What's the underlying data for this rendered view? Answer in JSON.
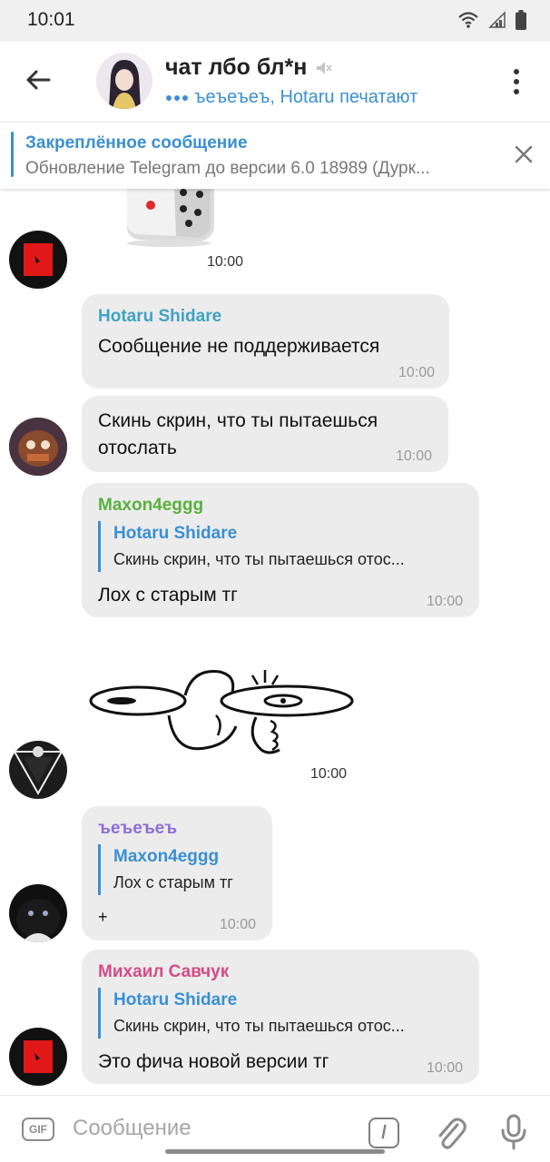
{
  "status": {
    "time": "10:01"
  },
  "header": {
    "title": "чат лбо бл*н",
    "subtitle": "ъеъеъеъ, Hotaru печатают"
  },
  "pinned": {
    "title": "Закреплённое сообщение",
    "text": "Обновление Telegram до версии 6.0 18989 (Дурк..."
  },
  "messages": [
    {
      "type": "sticker",
      "time": "10:00"
    },
    {
      "sender": "Hotaru Shidare",
      "text": "Сообщение не поддерживается",
      "time": "10:00",
      "sender_color": "#3fa2c4"
    },
    {
      "text_lines": [
        "Скинь скрин, что ты пытаешься",
        "отослать"
      ],
      "time": "10:00"
    },
    {
      "sender": "Maxon4eggg",
      "sender_color": "#58b03d",
      "reply": {
        "name": "Hotaru Shidare",
        "text": "Скинь скрин, что ты пытаешься отос..."
      },
      "text": "Лох с старым тг",
      "time": "10:00"
    },
    {
      "type": "sticker",
      "time": "10:00"
    },
    {
      "sender": "ъеъеъеъ",
      "sender_color": "#8c6fd8",
      "reply": {
        "name": "Maxon4eggg",
        "text": "Лох с старым тг"
      },
      "text": "+",
      "time": "10:00"
    },
    {
      "sender": "Михаил Савчук",
      "sender_color": "#d44b86",
      "reply": {
        "name": "Hotaru Shidare",
        "text": "Скинь скрин, что ты пытаешься отос..."
      },
      "text": "Это фича новой версии тг",
      "time": "10:00"
    }
  ],
  "composer": {
    "gif_label": "GIF",
    "placeholder": "Сообщение",
    "command_label": "/"
  },
  "icons": [
    "wifi-icon",
    "signal-icon",
    "battery-icon",
    "back-arrow-icon",
    "mute-icon",
    "typing-dots-icon",
    "menu-dots-icon",
    "close-icon",
    "attach-icon",
    "mic-icon"
  ],
  "colors": {
    "accent": "#3a8fd3",
    "bubble": "#ececec"
  }
}
